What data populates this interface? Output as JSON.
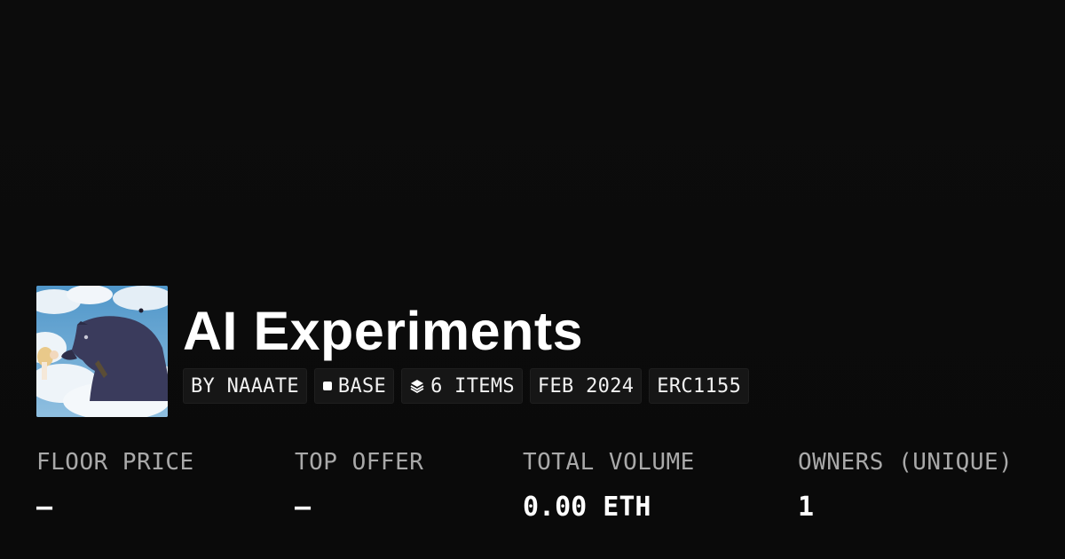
{
  "collection": {
    "name": "AI Experiments",
    "thumbnail_alt": "anime illustration of a dark wolf creature in the clouds",
    "chips": {
      "creator": "BY NAAATE",
      "chain": "BASE",
      "items": "6 ITEMS",
      "date": "FEB 2024",
      "standard": "ERC1155"
    }
  },
  "stats": {
    "floor_price": {
      "label": "FLOOR PRICE",
      "value": "–"
    },
    "top_offer": {
      "label": "TOP OFFER",
      "value": "–"
    },
    "total_volume": {
      "label": "TOTAL VOLUME",
      "value": "0.00 ETH"
    },
    "owners": {
      "label": "OWNERS (UNIQUE)",
      "value": "1"
    }
  },
  "icons": {
    "chain": "square-icon",
    "items": "layers-icon"
  },
  "colors": {
    "background": "#0b0b0b",
    "chip_background": "#161616",
    "label": "#a9a9a9",
    "value": "#ffffff"
  }
}
